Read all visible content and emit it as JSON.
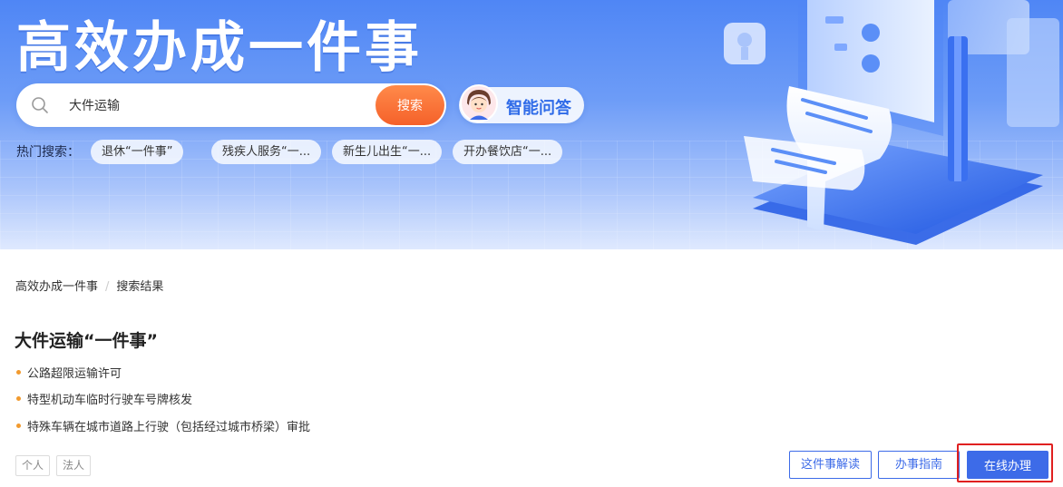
{
  "banner": {
    "title": "高效办成一件事"
  },
  "search": {
    "value": "大件运输",
    "placeholder": "",
    "button_label": "搜索"
  },
  "qa": {
    "label": "智能问答"
  },
  "hot_search": {
    "label": "热门搜索：",
    "tags": [
      "退休“一件事”",
      "残疾人服务“一...",
      "新生儿出生“一...",
      "开办餐饮店“一..."
    ]
  },
  "breadcrumb": {
    "home": "高效办成一件事",
    "current": "搜索结果"
  },
  "result": {
    "title": "大件运输“一件事”",
    "items": [
      "公路超限运输许可",
      "特型机动车临时行驶车号牌核发",
      "特殊车辆在城市道路上行驶（包括经过城市桥梁）审批"
    ],
    "tags": [
      "个人",
      "法人"
    ],
    "buttons": {
      "interpret": "这件事解读",
      "guide": "办事指南",
      "online": "在线办理"
    }
  },
  "colors": {
    "primary": "#3d6be8",
    "search_button": "#f5612a",
    "bullet": "#f29a2e",
    "highlight": "#e02020"
  }
}
